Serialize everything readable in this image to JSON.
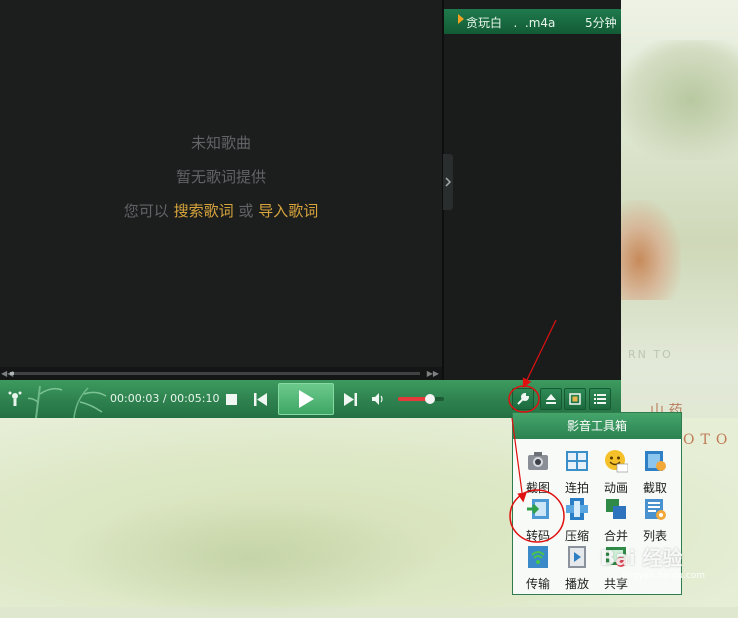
{
  "lyrics": {
    "song": "未知歌曲",
    "none": "暂无歌词提供",
    "hint_prefix": "您可以",
    "search_link": "搜索歌词",
    "or": "或",
    "import_link": "导入歌词"
  },
  "playlist": {
    "items": [
      {
        "name": "贪玩白   .  .m4a",
        "duration": "5分钟"
      }
    ]
  },
  "player": {
    "time": "00:00:03 / 00:05:10",
    "progress": 0.01,
    "volume": 0.7
  },
  "toolbox": {
    "title": "影音工具箱",
    "tools": [
      {
        "label": "截图",
        "icon": "camera-icon"
      },
      {
        "label": "连拍",
        "icon": "grid-capture-icon"
      },
      {
        "label": "动画",
        "icon": "gif-smiley-icon"
      },
      {
        "label": "截取",
        "icon": "film-cut-icon"
      },
      {
        "label": "转码",
        "icon": "convert-icon"
      },
      {
        "label": "压缩",
        "icon": "compress-icon"
      },
      {
        "label": "合并",
        "icon": "merge-icon"
      },
      {
        "label": "列表",
        "icon": "list-settings-icon"
      },
      {
        "label": "传输",
        "icon": "wifi-transfer-icon"
      },
      {
        "label": "播放",
        "icon": "play-file-icon"
      },
      {
        "label": "共享",
        "icon": "share-icon"
      }
    ]
  },
  "background": {
    "text_latin": "OTO",
    "text_cjk": "山 药",
    "text_small": "RN TO"
  },
  "watermark": {
    "brand": "Bai 经验",
    "url": "jingyan.baidu.com"
  },
  "colors": {
    "accent_green": "#2f8350",
    "link_gold": "#d7a43c",
    "annotation_red": "#e01010"
  }
}
